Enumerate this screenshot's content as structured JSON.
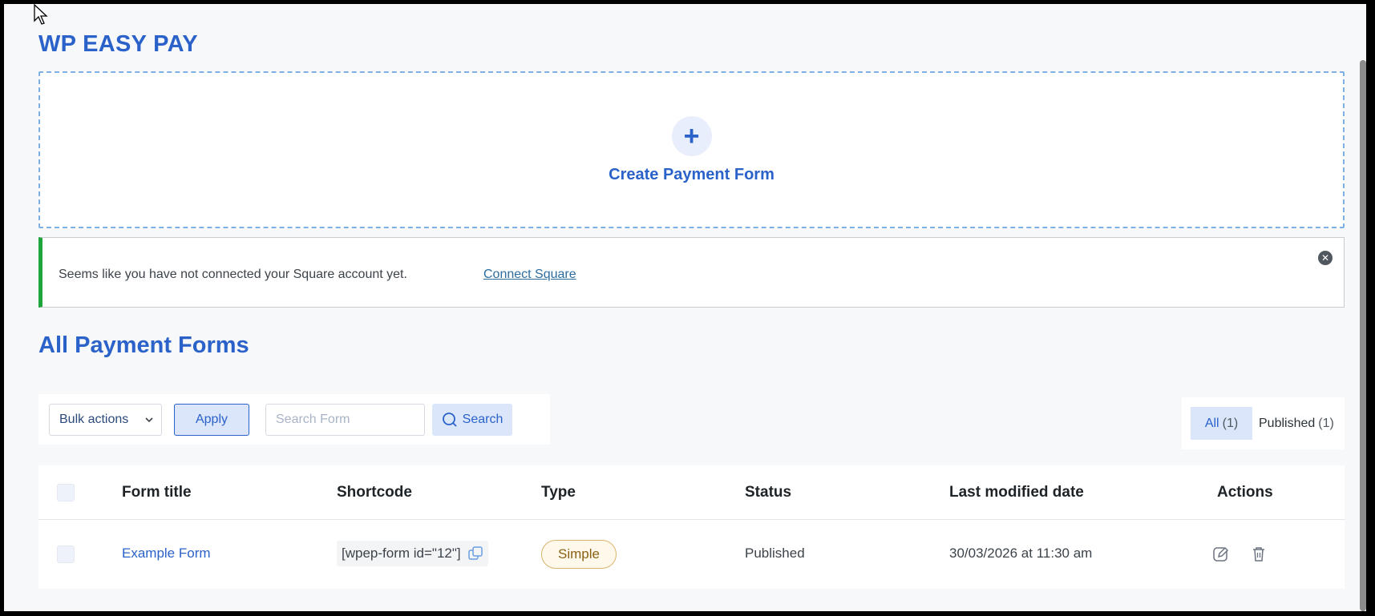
{
  "brand": "WP EASY PAY",
  "create": {
    "label": "Create Payment Form",
    "icon": "plus-icon"
  },
  "notice": {
    "message": "Seems like you have not connected your Square account yet.",
    "link": "Connect Square",
    "close_icon": "close-circle-icon",
    "accent_color": "#1ea53d"
  },
  "section_title": "All Payment Forms",
  "toolbar": {
    "bulk_label": "Bulk actions",
    "apply_label": "Apply",
    "search_placeholder": "Search Form",
    "search_label": "Search"
  },
  "filters": {
    "all_label": "All",
    "all_count": "(1)",
    "published_label": "Published",
    "published_count": "(1)"
  },
  "table": {
    "headers": [
      "Form title",
      "Shortcode",
      "Type",
      "Status",
      "Last modified date",
      "Actions"
    ],
    "rows": [
      {
        "title": "Example Form",
        "shortcode": "[wpep-form id=\"12\"]",
        "type": "Simple",
        "status": "Published",
        "modified": "30/03/2026 at 11:30 am"
      }
    ]
  },
  "colors": {
    "brand": "#2a62c9",
    "accent_bg": "#dbe6fa"
  }
}
